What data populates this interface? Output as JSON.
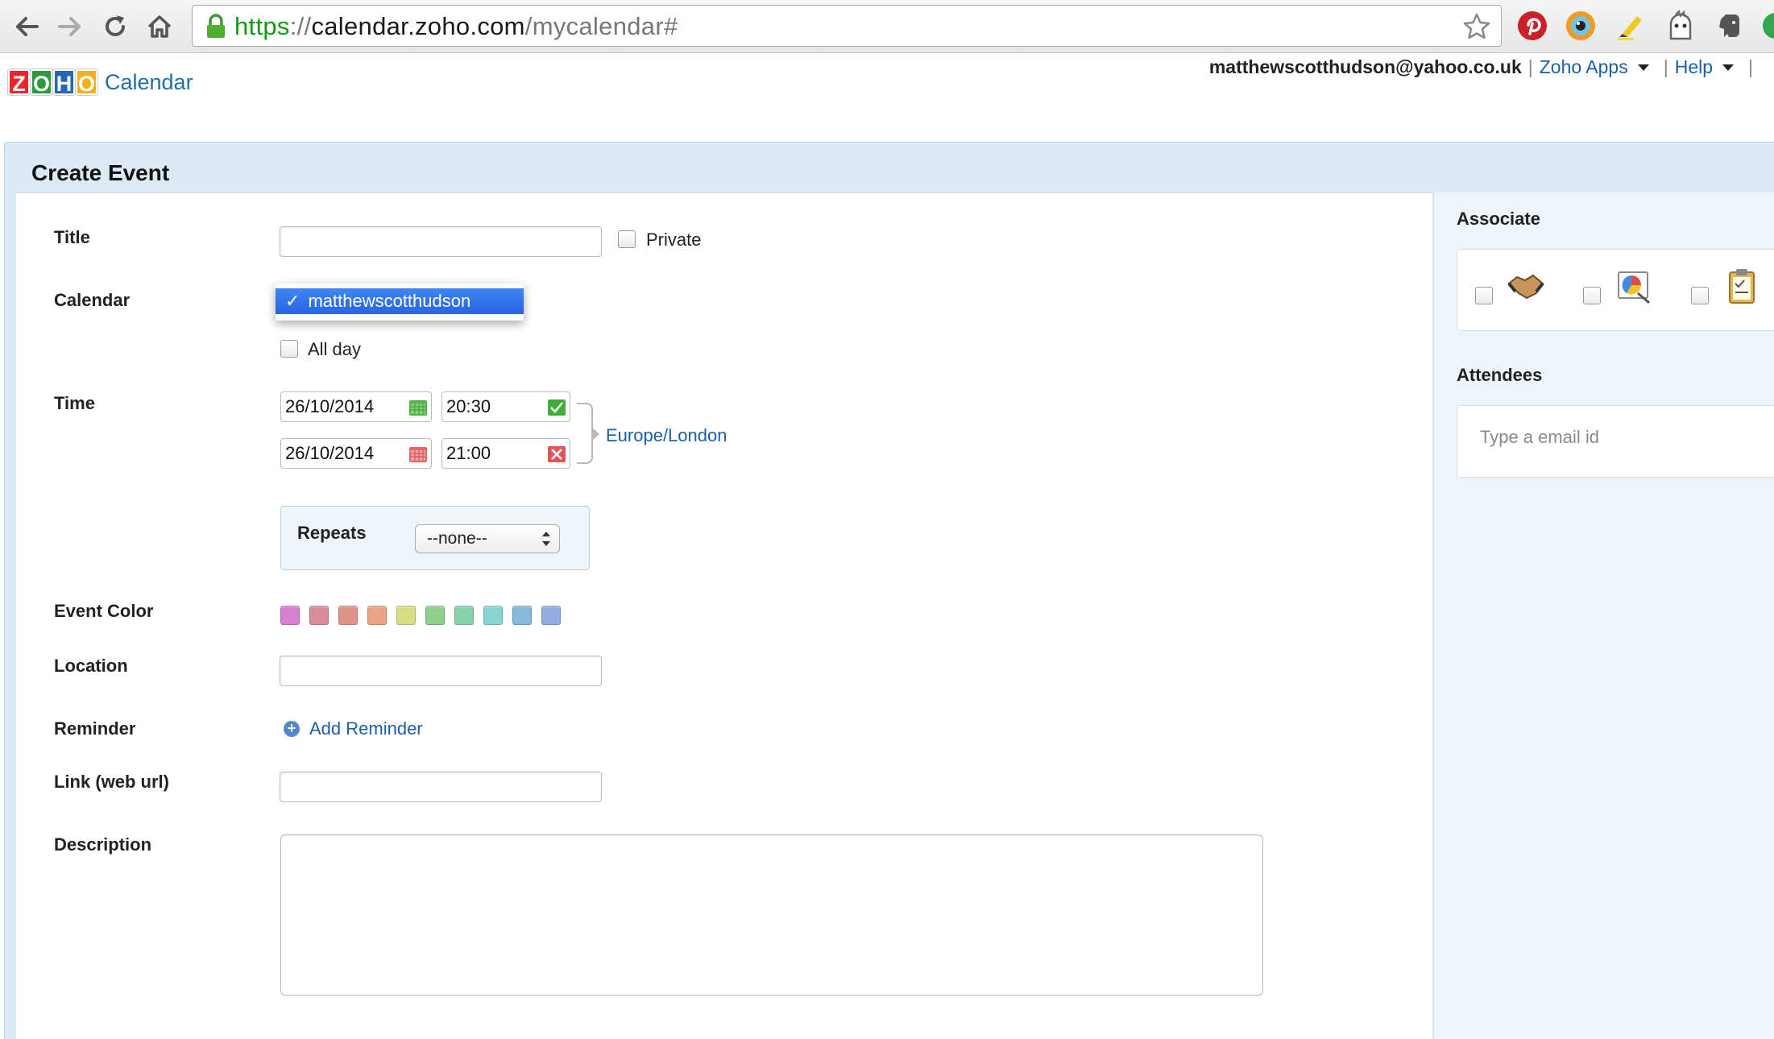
{
  "browser": {
    "url_scheme": "https",
    "url_sep": "://",
    "url_host": "calendar.zoho.com",
    "url_path": "/mycalendar#"
  },
  "header": {
    "logo_letters": [
      "Z",
      "O",
      "H",
      "O"
    ],
    "logo_colors": [
      "#e8262b",
      "#2a9a3a",
      "#2466b8",
      "#f2b01e"
    ],
    "app_name": "Calendar",
    "user": "matthewscotthudson@yahoo.co.uk",
    "sep": "|",
    "apps_link": "Zoho Apps",
    "help_link": "Help"
  },
  "form": {
    "title": "Create Event",
    "labels": {
      "title": "Title",
      "calendar": "Calendar",
      "time": "Time",
      "event_color": "Event Color",
      "location": "Location",
      "reminder": "Reminder",
      "link": "Link (web url)",
      "description": "Description"
    },
    "title_value": "",
    "private_label": "Private",
    "calendar_selected": "matthewscotthudson",
    "calendar_check": "✓",
    "all_day_label": "All day",
    "start_date": "26/10/2014",
    "start_time": "20:30",
    "end_date": "26/10/2014",
    "end_time": "21:00",
    "timezone": "Europe/London",
    "repeats_label": "Repeats",
    "repeats_value": "--none--",
    "event_colors": [
      "#d77fd2",
      "#d98d9a",
      "#e09388",
      "#eca287",
      "#d9dc81",
      "#8ed08a",
      "#87d3a9",
      "#86d5d4",
      "#87b9df",
      "#8faedf"
    ],
    "add_reminder": "Add Reminder",
    "location_value": "",
    "link_value": "",
    "description_value": ""
  },
  "sidebar": {
    "associate_title": "Associate",
    "attendees_title": "Attendees",
    "attendees_placeholder": "Type a email id"
  }
}
